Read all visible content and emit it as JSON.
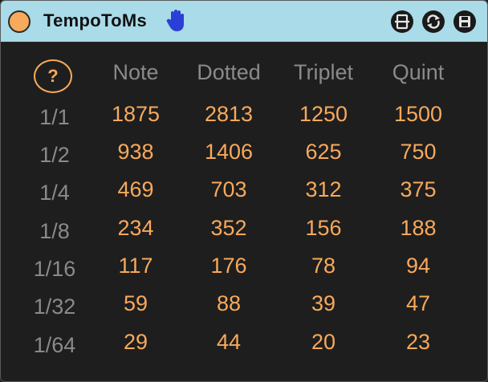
{
  "window": {
    "title": "TempoToMs",
    "accent": "#f7a95c",
    "titlebar_bg": "#a9dbe8"
  },
  "icons": {
    "power": "power-toggle-icon",
    "hand": "hand-icon",
    "b1": "pin-icon",
    "b2": "refresh-icon",
    "b3": "save-icon"
  },
  "help_label": "?",
  "columns": [
    "Note",
    "Dotted",
    "Triplet",
    "Quint"
  ],
  "rows": [
    {
      "label": "1/1",
      "values": [
        "1875",
        "2813",
        "1250",
        "1500"
      ]
    },
    {
      "label": "1/2",
      "values": [
        "938",
        "1406",
        "625",
        "750"
      ]
    },
    {
      "label": "1/4",
      "values": [
        "469",
        "703",
        "312",
        "375"
      ]
    },
    {
      "label": "1/8",
      "values": [
        "234",
        "352",
        "156",
        "188"
      ]
    },
    {
      "label": "1/16",
      "values": [
        "117",
        "176",
        "78",
        "94"
      ]
    },
    {
      "label": "1/32",
      "values": [
        "59",
        "88",
        "39",
        "47"
      ]
    },
    {
      "label": "1/64",
      "values": [
        "29",
        "44",
        "20",
        "23"
      ]
    }
  ]
}
